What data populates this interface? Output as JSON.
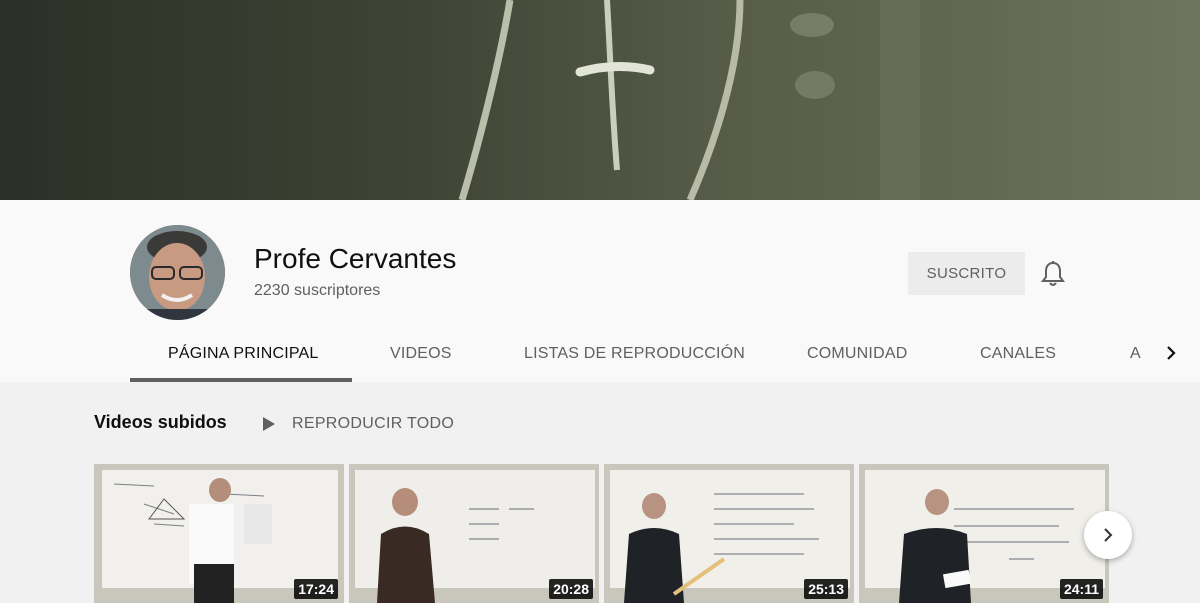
{
  "channel": {
    "name": "Profe Cervantes",
    "subscribers": "2230 suscriptores",
    "subscribe_label": "SUSCRITO"
  },
  "tabs": [
    {
      "label": "PÁGINA PRINCIPAL",
      "active": true
    },
    {
      "label": "VIDEOS"
    },
    {
      "label": "LISTAS DE REPRODUCCIÓN"
    },
    {
      "label": "COMUNIDAD"
    },
    {
      "label": "CANALES"
    },
    {
      "label": "A"
    }
  ],
  "section": {
    "title": "Videos subidos",
    "play_all_label": "REPRODUCIR TODO"
  },
  "videos": [
    {
      "duration": "17:24"
    },
    {
      "duration": "20:28"
    },
    {
      "duration": "25:13"
    },
    {
      "duration": "24:11"
    }
  ],
  "icons": {
    "bell": "bell-icon",
    "tabs_next": "chevron-right-icon",
    "play_all": "play-icon",
    "carousel_next": "chevron-right-icon"
  }
}
